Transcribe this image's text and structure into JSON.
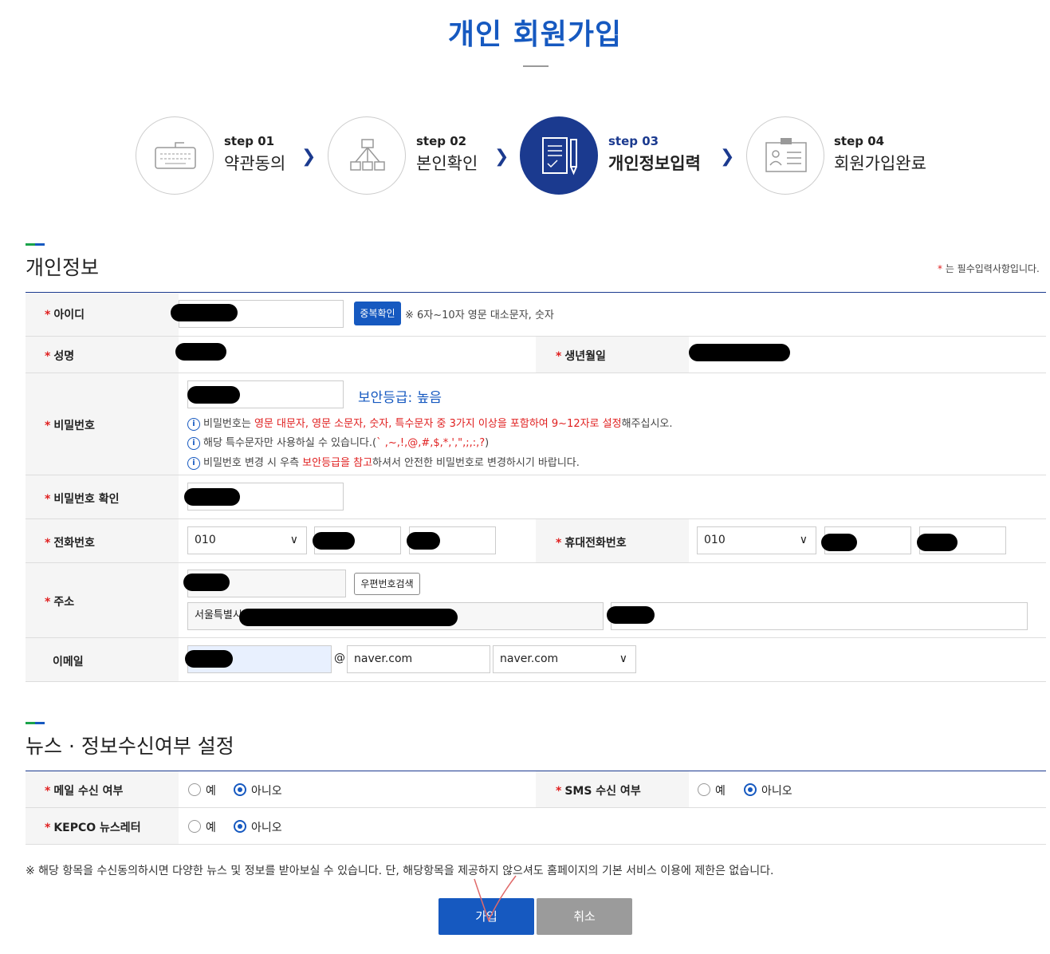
{
  "page": {
    "title": "개인 회원가입"
  },
  "steps": [
    {
      "num": "step 01",
      "label": "약관동의",
      "icon": "keyboard-icon",
      "active": false
    },
    {
      "num": "step 02",
      "label": "본인확인",
      "icon": "hierarchy-icon",
      "active": false
    },
    {
      "num": "step 03",
      "label": "개인정보입력",
      "icon": "document-pencil-icon",
      "active": true
    },
    {
      "num": "step 04",
      "label": "회원가입완료",
      "icon": "id-card-icon",
      "active": false
    }
  ],
  "personal": {
    "section_title": "개인정보",
    "required_note_star": "*",
    "required_note": " 는 필수입력사항입니다.",
    "id_label": "아이디",
    "dup_check_button": "중복확인",
    "id_hint": "※ 6자~10자 영문 대소문자, 숫자",
    "name_label": "성명",
    "birth_label": "생년월일",
    "password_label": "비밀번호",
    "security_level": "보안등급: 높음",
    "pw_hint1_a": "비밀번호는 ",
    "pw_hint1_b": "영문 대문자, 영문 소문자, 숫자, 특수문자 중 3가지 이상을 포함하여 9~12자로 설정",
    "pw_hint1_c": "해주십시오.",
    "pw_hint2_a": "해당 특수문자만 사용하실 수 있습니다.(",
    "pw_hint2_b": "` ,~,!,@,#,$,*,',\",;,:,?",
    "pw_hint2_c": ")",
    "pw_hint3_a": "비밀번호 변경 시 우측 ",
    "pw_hint3_b": "보안등급을 참고",
    "pw_hint3_c": "하셔서 안전한 비밀번호로 변경하시기 바랍니다.",
    "password_confirm_label": "비밀번호 확인",
    "phone_label": "전화번호",
    "phone_prefix": "010",
    "mobile_label": "휴대전화번호",
    "mobile_prefix": "010",
    "address_label": "주소",
    "zip_button": "우편번호검색",
    "address_line1": "서울특별시",
    "email_label": "이메일",
    "email_at": "@",
    "email_domain": "naver.com",
    "email_domain_select": "naver.com"
  },
  "news": {
    "section_title": "뉴스 · 정보수신여부 설정",
    "mail_label": "메일 수신 여부",
    "sms_label": "SMS 수신 여부",
    "newsletter_label": "KEPCO 뉴스레터",
    "yes": "예",
    "no": "아니오",
    "mail_selected": "아니오",
    "sms_selected": "아니오",
    "newsletter_selected": "아니오"
  },
  "notice": "※ 해당 항목을 수신동의하시면 다양한 뉴스 및 정보를 받아보실 수 있습니다. 단, 해당항목을 제공하지 않으셔도 홈페이지의 기본 서비스 이용에 제한은 없습니다.",
  "buttons": {
    "join": "가입",
    "cancel": "취소"
  },
  "colors": {
    "primary": "#1659c0",
    "step_active": "#1b3a8f",
    "required": "#e02020",
    "cancel": "#9b9b9b"
  }
}
